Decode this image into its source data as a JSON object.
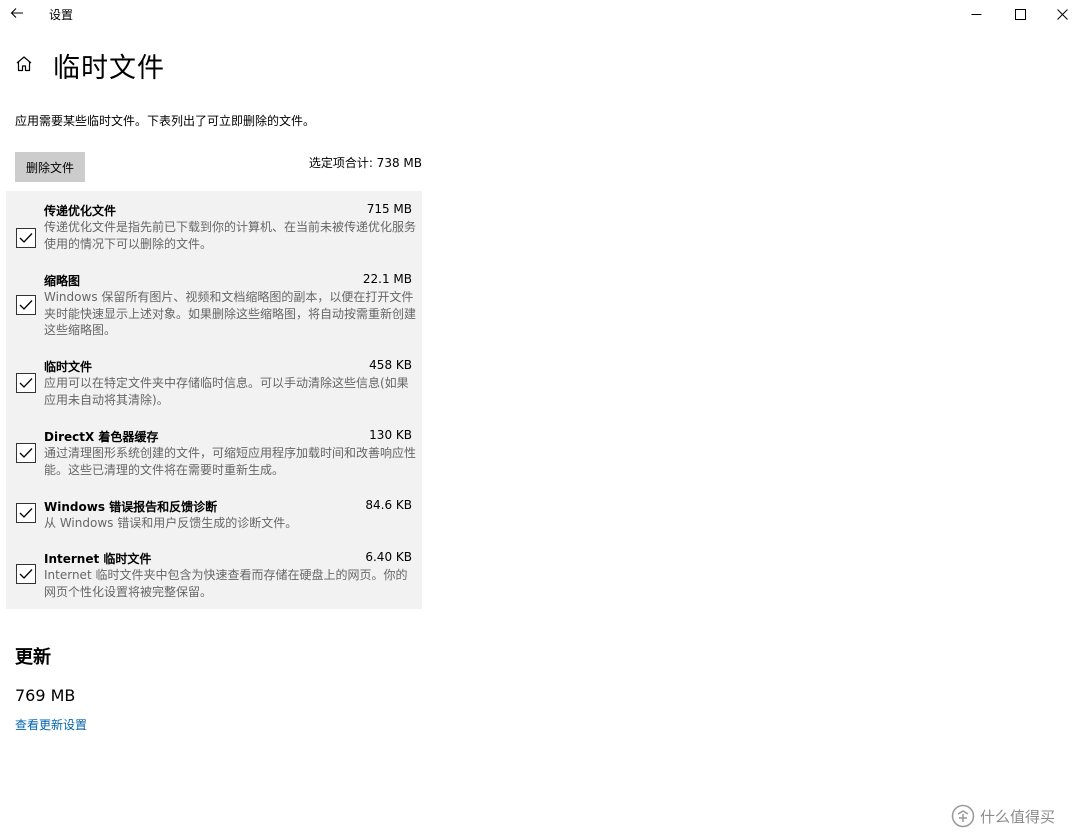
{
  "window": {
    "app_title": "设置"
  },
  "header": {
    "page_title": "临时文件"
  },
  "description": "应用需要某些临时文件。下表列出了可立即删除的文件。",
  "toolbar": {
    "delete_label": "删除文件",
    "total_selected": "选定项合计: 738 MB"
  },
  "items": [
    {
      "title": "传递优化文件",
      "size": "715 MB",
      "description": "传递优化文件是指先前已下载到你的计算机、在当前未被传递优化服务使用的情况下可以删除的文件。",
      "checked": true
    },
    {
      "title": "缩略图",
      "size": "22.1 MB",
      "description": "Windows 保留所有图片、视频和文档缩略图的副本，以便在打开文件夹时能快速显示上述对象。如果删除这些缩略图，将自动按需重新创建这些缩略图。",
      "checked": true
    },
    {
      "title": "临时文件",
      "size": "458 KB",
      "description": "应用可以在特定文件夹中存储临时信息。可以手动清除这些信息(如果应用未自动将其清除)。",
      "checked": true
    },
    {
      "title": "DirectX 着色器缓存",
      "size": "130 KB",
      "description": "通过清理图形系统创建的文件，可缩短应用程序加载时间和改善响应性能。这些已清理的文件将在需要时重新生成。",
      "checked": true
    },
    {
      "title": "Windows 错误报告和反馈诊断",
      "size": "84.6 KB",
      "description": "从 Windows 错误和用户反馈生成的诊断文件。",
      "checked": true
    },
    {
      "title": "Internet 临时文件",
      "size": "6.40 KB",
      "description": "Internet 临时文件夹中包含为快速查看而存储在硬盘上的网页。你的网页个性化设置将被完整保留。",
      "checked": true
    }
  ],
  "updates": {
    "section_title": "更新",
    "size": "769 MB",
    "link_label": "查看更新设置"
  },
  "watermark": {
    "text": "什么值得买"
  },
  "icons": {
    "back": "arrow-left-icon",
    "home": "home-icon",
    "check": "checkmark-icon",
    "minimize": "minimize-icon",
    "maximize": "maximize-icon",
    "close": "close-icon"
  },
  "colors": {
    "link": "#0063b1",
    "panel_bg": "#f2f2f2",
    "button_bg": "#cccccc",
    "secondary_text": "#666666"
  }
}
